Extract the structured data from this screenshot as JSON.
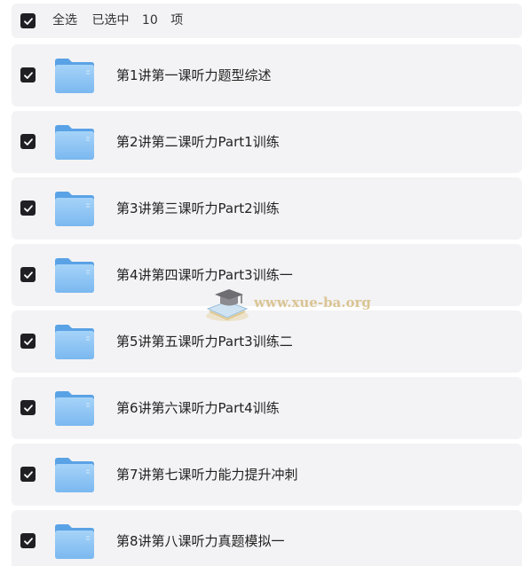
{
  "header": {
    "select_all_label": "全选",
    "selected_prefix": "已选中",
    "selected_count": "10",
    "selected_suffix": "项"
  },
  "files": [
    {
      "name": "第1讲第一课听力题型综述",
      "checked": true
    },
    {
      "name": "第2讲第二课听力Part1训练",
      "checked": true
    },
    {
      "name": "第3讲第三课听力Part2训练",
      "checked": true
    },
    {
      "name": "第4讲第四课听力Part3训练一",
      "checked": true
    },
    {
      "name": "第5讲第五课听力Part3训练二",
      "checked": true
    },
    {
      "name": "第6讲第六课听力Part4训练",
      "checked": true
    },
    {
      "name": "第7讲第七课听力能力提升冲刺",
      "checked": true
    },
    {
      "name": "第8讲第八课听力真题模拟一",
      "checked": true
    }
  ],
  "watermark": {
    "text": "www.xue-ba.org"
  },
  "colors": {
    "row_background": "#f3f3f5",
    "checkbox_fill": "#1f1f24",
    "folder_blue": "#7ab8f0"
  },
  "icons": {
    "checkbox": "checkbox-checked-icon",
    "folder": "folder-icon",
    "watermark_logo": "graduation-cap-book-icon"
  }
}
